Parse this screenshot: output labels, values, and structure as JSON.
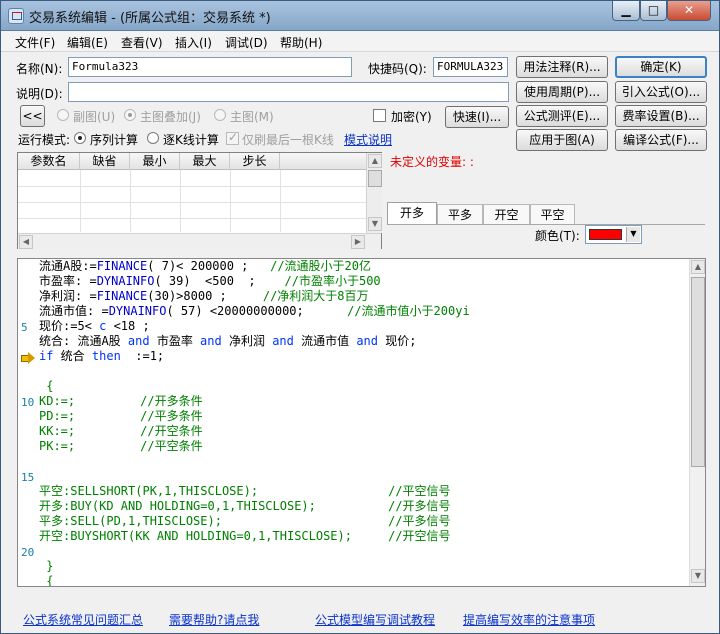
{
  "window": {
    "title": "交易系统编辑 - (所属公式组：交易系统 *)",
    "controls": [
      "▁",
      "□",
      "✕"
    ]
  },
  "menu": [
    "文件(F)",
    "编辑(E)",
    "查看(V)",
    "插入(I)",
    "调试(D)",
    "帮助(H)"
  ],
  "form": {
    "name_label": "名称(N):",
    "name_value": "Formula323",
    "hotkey_label": "快捷码(Q):",
    "hotkey_value": "FORMULA323",
    "desc_label": "说明(D):",
    "desc_value": "",
    "collapse": "<<",
    "sub_chart": "副图(U)",
    "main_overlay": "主图叠加(J)",
    "main_chart": "主图(M)",
    "encrypt": "加密(Y)",
    "fast": "快速(I)...",
    "run_mode": "运行模式:",
    "sequential": "序列计算",
    "by_k": "逐K线计算",
    "last_k_only": "仅刷最后一根K线",
    "mode_help": "模式说明"
  },
  "buttons": {
    "usage_notes": "用法注释(R)...",
    "ok": "确定(K)",
    "period": "使用周期(P)...",
    "import": "引入公式(O)...",
    "evaluate": "公式测评(E)...",
    "fee": "费率设置(B)...",
    "apply": "应用于图(A)",
    "compile": "编译公式(F)..."
  },
  "param_table": {
    "columns": [
      "参数名",
      "缺省",
      "最小",
      "最大",
      "步长"
    ]
  },
  "undefined_vars": "未定义的变量: :",
  "signal_tabs": [
    "开多",
    "平多",
    "开空",
    "平空"
  ],
  "color_label": "颜色(T):",
  "colors": {
    "signal": "#ff0000",
    "keyword": "#0033ff",
    "comment": "#008000",
    "function": "#0000cc"
  },
  "code_lines": [
    [
      {
        "t": "流通A股:=",
        "c": "plain"
      },
      {
        "t": "FINANCE",
        "c": "func"
      },
      {
        "t": "( 7)< 200000 ;   ",
        "c": "plain"
      },
      {
        "t": "//流通股小于20亿",
        "c": "comment"
      }
    ],
    [
      {
        "t": "市盈率: =",
        "c": "plain"
      },
      {
        "t": "DYNAINFO",
        "c": "func"
      },
      {
        "t": "( 39)  <500  ;   ",
        "c": "plain"
      },
      {
        "t": " //市盈率小于500",
        "c": "comment"
      }
    ],
    [
      {
        "t": "净利润: =",
        "c": "plain"
      },
      {
        "t": "FINANCE",
        "c": "func"
      },
      {
        "t": "(30)>8000 ;     ",
        "c": "plain"
      },
      {
        "t": "//净利润大于8百万",
        "c": "comment"
      }
    ],
    [
      {
        "t": "流通市值: =",
        "c": "plain"
      },
      {
        "t": "DYNAINFO",
        "c": "func"
      },
      {
        "t": "( 57) <20000000000;      ",
        "c": "plain"
      },
      {
        "t": "//流通市值小于200yi",
        "c": "comment"
      }
    ],
    [
      {
        "t": "现价:=5< ",
        "c": "plain"
      },
      {
        "t": "c",
        "c": "keyword"
      },
      {
        "t": " <18 ;",
        "c": "plain"
      }
    ],
    [
      {
        "t": "统合: 流通A股 ",
        "c": "plain"
      },
      {
        "t": "and",
        "c": "keyword"
      },
      {
        "t": " 市盈率 ",
        "c": "plain"
      },
      {
        "t": "and",
        "c": "keyword"
      },
      {
        "t": " 净利润 ",
        "c": "plain"
      },
      {
        "t": "and",
        "c": "keyword"
      },
      {
        "t": " 流通市值 ",
        "c": "plain"
      },
      {
        "t": "and",
        "c": "keyword"
      },
      {
        "t": " 现价;",
        "c": "plain"
      }
    ],
    [
      {
        "t": "if",
        "c": "keyword"
      },
      {
        "t": " 统合 ",
        "c": "plain"
      },
      {
        "t": "then",
        "c": "keyword"
      },
      {
        "t": "  :=1;",
        "c": "plain"
      }
    ],
    [],
    [
      {
        "t": " {",
        "c": "comment"
      }
    ],
    [
      {
        "t": "KD:=;         ",
        "c": "comment"
      },
      {
        "t": "//开多条件",
        "c": "comment"
      }
    ],
    [
      {
        "t": "PD:=;         ",
        "c": "comment"
      },
      {
        "t": "//平多条件",
        "c": "comment"
      }
    ],
    [
      {
        "t": "KK:=;         ",
        "c": "comment"
      },
      {
        "t": "//开空条件",
        "c": "comment"
      }
    ],
    [
      {
        "t": "PK:=;         ",
        "c": "comment"
      },
      {
        "t": "//平空条件",
        "c": "comment"
      }
    ],
    [],
    [],
    [
      {
        "t": "平空:SELLSHORT(PK,1,THISCLOSE);                  //平空信号",
        "c": "comment"
      }
    ],
    [
      {
        "t": "开多:BUY(KD AND HOLDING=0,1,THISCLOSE);          //开多信号",
        "c": "comment"
      }
    ],
    [
      {
        "t": "平多:SELL(PD,1,THISCLOSE);                       //平多信号",
        "c": "comment"
      }
    ],
    [
      {
        "t": "开空:BUYSHORT(KK AND HOLDING=0,1,THISCLOSE);     //开空信号",
        "c": "comment"
      }
    ],
    [],
    [
      {
        "t": " }",
        "c": "comment"
      }
    ],
    [
      {
        "t": " {",
        "c": "comment"
      }
    ]
  ],
  "line_numbers": [
    "5",
    "10",
    "15",
    "20"
  ],
  "bottom_links": [
    "公式系统常见问题汇总",
    "需要帮助?请点我",
    "公式模型编写调试教程",
    "提高编写效率的注意事项"
  ]
}
